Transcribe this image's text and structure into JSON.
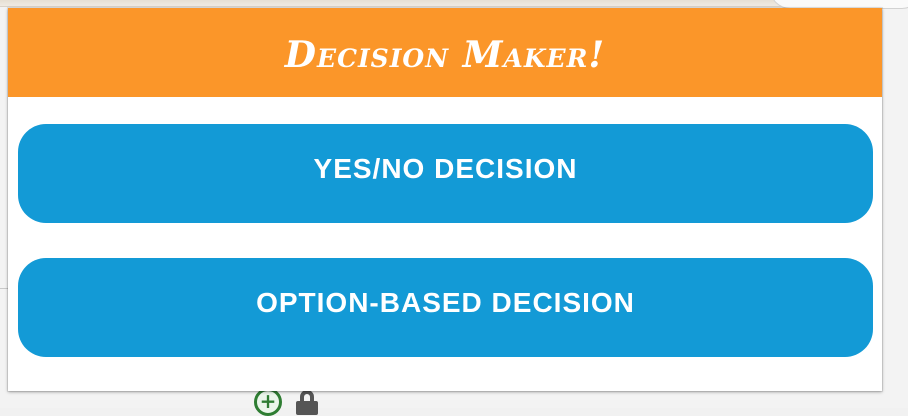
{
  "popup": {
    "title": "Decision Maker!",
    "buttons": {
      "yes_no_label": "YES/NO DECISION",
      "option_based_label": "OPTION-BASED DECISION"
    }
  },
  "browser": {
    "bottom_icons": [
      "plus-circle-icon",
      "lock-icon"
    ]
  },
  "colors": {
    "header": "#fb9629",
    "button": "#139ad6",
    "text": "#ffffff"
  }
}
